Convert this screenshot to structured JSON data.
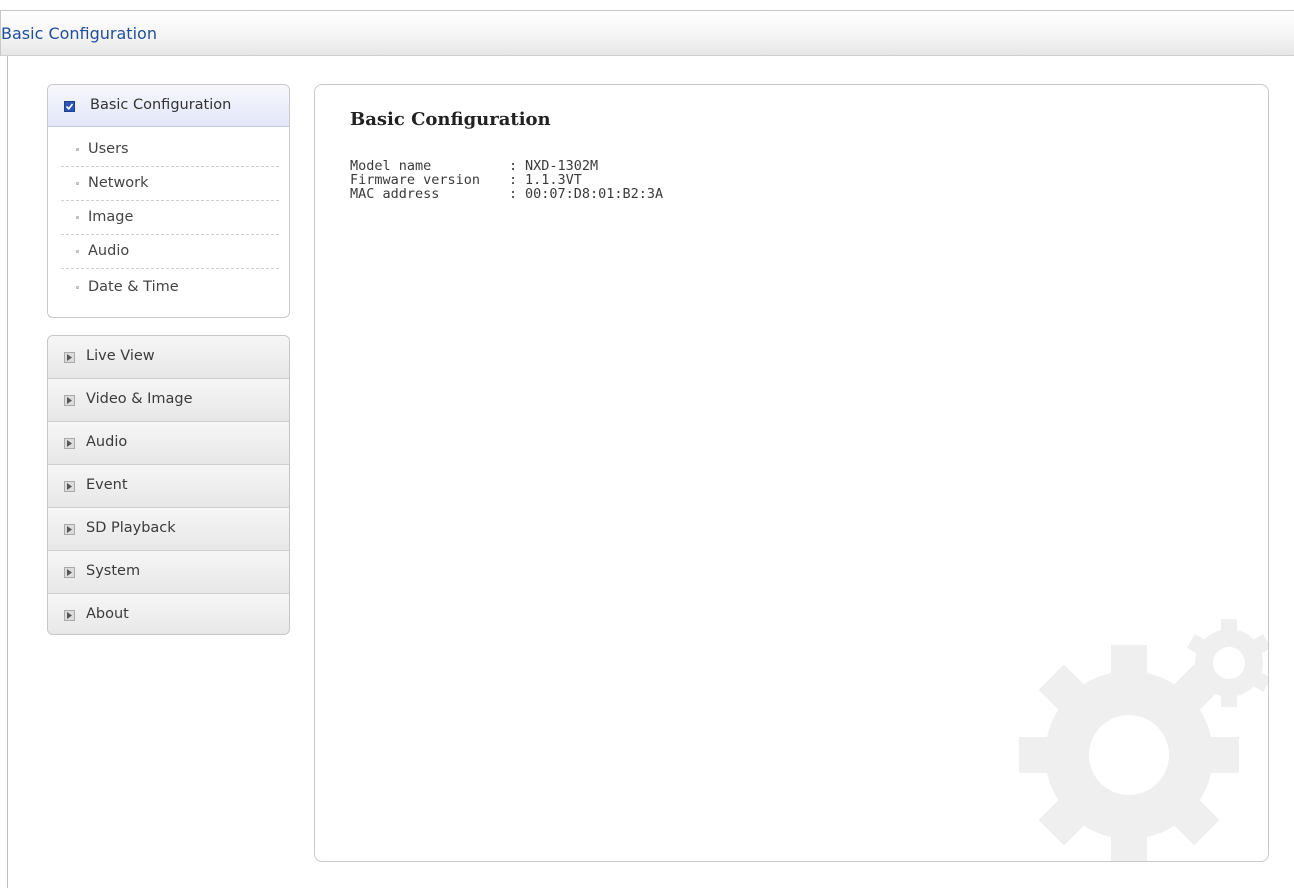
{
  "header": {
    "title": "Basic Configuration"
  },
  "sidebar": {
    "active_group": {
      "label": "Basic Configuration",
      "icon": "checkbox-icon",
      "items": [
        {
          "label": "Users"
        },
        {
          "label": "Network"
        },
        {
          "label": "Image"
        },
        {
          "label": "Audio"
        },
        {
          "label": "Date & Time"
        }
      ]
    },
    "menu": [
      {
        "label": "Live View",
        "icon": "arrow-right-icon"
      },
      {
        "label": "Video & Image",
        "icon": "arrow-right-icon"
      },
      {
        "label": "Audio",
        "icon": "arrow-right-icon"
      },
      {
        "label": "Event",
        "icon": "arrow-right-icon"
      },
      {
        "label": "SD Playback",
        "icon": "arrow-right-icon"
      },
      {
        "label": "System",
        "icon": "arrow-right-icon"
      },
      {
        "label": "About",
        "icon": "arrow-right-icon"
      }
    ]
  },
  "main": {
    "title": "Basic Configuration",
    "info": [
      {
        "label": "Model name",
        "separator": ":",
        "value": "NXD-1302M"
      },
      {
        "label": "Firmware version",
        "separator": ":",
        "value": "1.1.3VT"
      },
      {
        "label": "MAC address",
        "separator": ":",
        "value": "00:07:D8:01:B2:3A"
      }
    ]
  },
  "colors": {
    "title_blue": "#1f4e9a",
    "active_header": "#e2e6f7",
    "checkbox_blue": "#2d55b5",
    "menu_gray": "#e7e7e7",
    "border": "#c9c9c9",
    "gear_watermark": "#f0f0f0"
  }
}
